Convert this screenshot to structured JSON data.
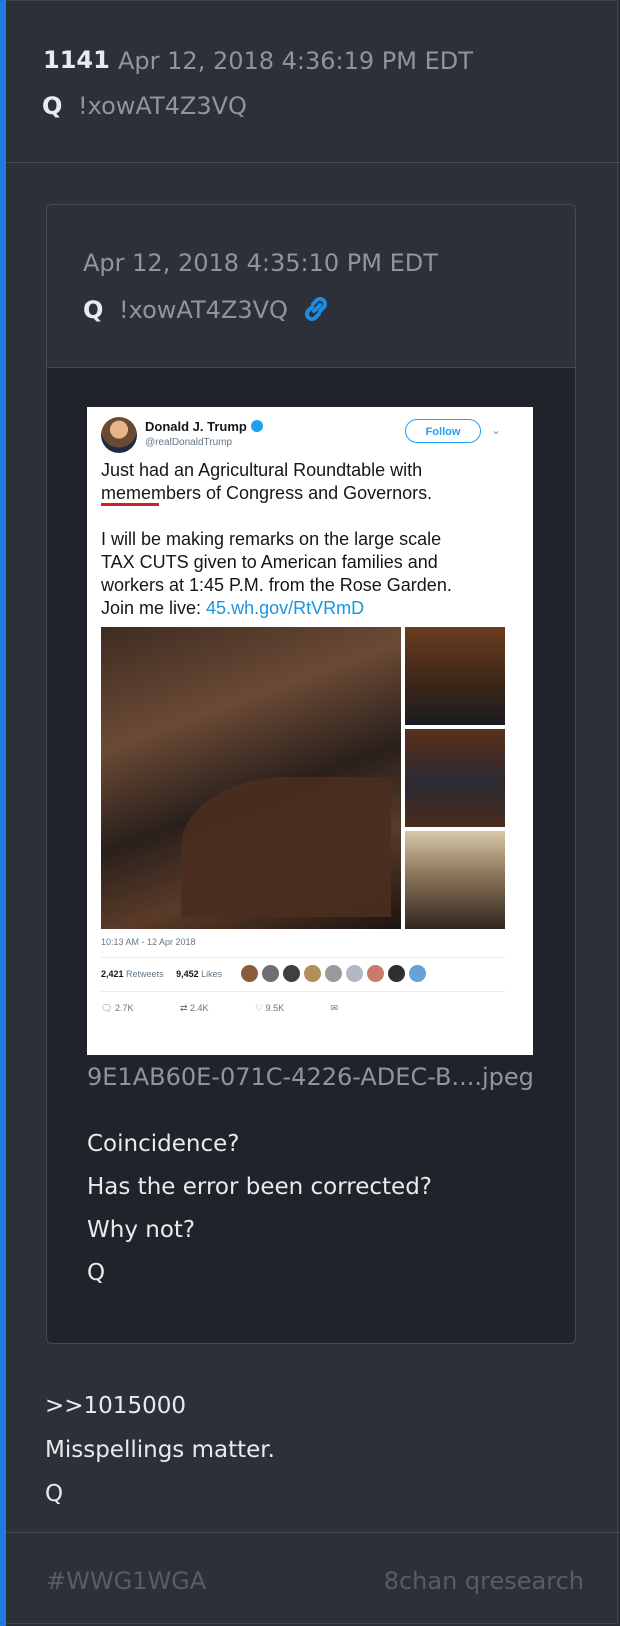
{
  "post": {
    "number": "1141",
    "timestamp": "Apr 12, 2018 4:36:19 PM EDT",
    "author": "Q",
    "tripcode": "!xowAT4Z3VQ"
  },
  "quoted": {
    "timestamp": "Apr 12, 2018 4:35:10 PM EDT",
    "author": "Q",
    "tripcode": "!xowAT4Z3VQ",
    "link_icon": "link-icon",
    "image": {
      "filename": "9E1AB60E-071C-4226-ADEC-B....jpeg",
      "tweet": {
        "name": "Donald J. Trump",
        "handle": "@realDonaldTrump",
        "follow": "Follow",
        "line1": "Just had an Agricultural Roundtable with",
        "line2": "memembers of Congress and Governors.",
        "line3": "I will be making remarks on the large scale",
        "line4": "TAX CUTS given to American families and",
        "line5": "workers at 1:45 P.M. from the Rose Garden.",
        "line6_prefix": "Join me live: ",
        "link": "45.wh.gov/RtVRmD",
        "time": "10:13 AM - 12 Apr 2018",
        "retweets_count": "2,421",
        "retweets_label": "Retweets",
        "likes_count": "9,452",
        "likes_label": "Likes",
        "replies": "2.7K",
        "rts": "2.4K",
        "likes_short": "9.5K"
      }
    },
    "message": [
      "Coincidence?",
      "Has the error been corrected?",
      "Why not?",
      "Q"
    ]
  },
  "reply": [
    "&gt;&gt;1015000",
    "Misspellings matter.",
    "Q"
  ],
  "footer": {
    "hashtag": "#WWG1WGA",
    "source": "8chan qresearch"
  },
  "colors": {
    "accent": "#1e7ce0",
    "link": "#1b95e0"
  }
}
